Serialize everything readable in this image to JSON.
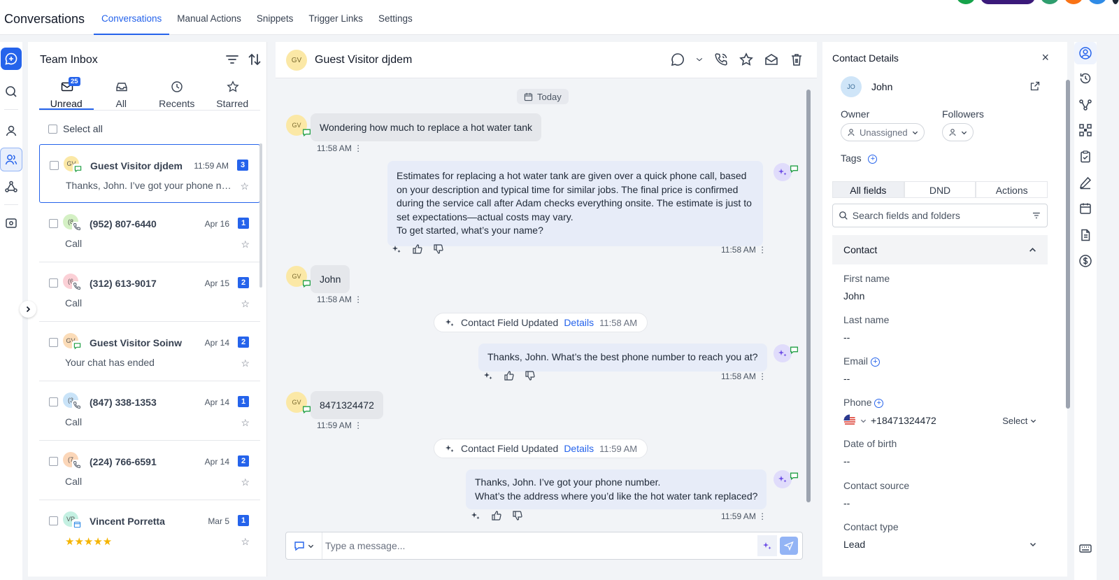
{
  "app": {
    "title": "Conversations"
  },
  "nav": {
    "tabs": [
      "Conversations",
      "Manual Actions",
      "Snippets",
      "Trigger Links",
      "Settings"
    ]
  },
  "colors": {
    "accent": "#2563eb",
    "avatar_gv": "#fbe8a6",
    "bubble_out": "#e7ecf8",
    "bubble_in": "#e5e7eb"
  },
  "inbox": {
    "title": "Team Inbox",
    "tabs": [
      {
        "label": "Unread",
        "badge": "25",
        "icon": "inbox-icon"
      },
      {
        "label": "All",
        "icon": "tray-icon"
      },
      {
        "label": "Recents",
        "icon": "clock-icon"
      },
      {
        "label": "Starred",
        "icon": "star-icon"
      }
    ],
    "select_all": "Select all",
    "conversations": [
      {
        "initials": "GV",
        "name": "Guest Visitor djdem",
        "time": "11:59 AM",
        "count": "3",
        "preview": "Thanks, John. I’ve got your phone number. What’s the address where you’d like the hot water tank replaced?",
        "avatar_color": "#fbe8a6"
      },
      {
        "initials": "(8",
        "name": "(952) 807-6440",
        "time": "Apr 16",
        "count": "1",
        "preview": "Call",
        "avatar_color": "#d4f0c4"
      },
      {
        "initials": "(6",
        "name": "(312) 613-9017",
        "time": "Apr 15",
        "count": "2",
        "preview": "Call",
        "avatar_color": "#fbd0d6"
      },
      {
        "initials": "GV",
        "name": "Guest Visitor Soinw",
        "time": "Apr 14",
        "count": "2",
        "preview": "Your chat has ended",
        "avatar_color": "#fbdcb8"
      },
      {
        "initials": "(3",
        "name": "(847) 338-1353",
        "time": "Apr 14",
        "count": "1",
        "preview": "Call",
        "avatar_color": "#c9e3f8"
      },
      {
        "initials": "(7",
        "name": "(224) 766-6591",
        "time": "Apr 14",
        "count": "2",
        "preview": "Call",
        "avatar_color": "#fbd6b8"
      },
      {
        "initials": "VP",
        "name": "Vincent Porretta",
        "time": "Mar 5",
        "count": "1",
        "preview": "★★★★★",
        "avatar_color": "#c4f0e2"
      }
    ]
  },
  "chat": {
    "contact_initials": "GV",
    "contact_name": "Guest Visitor djdem",
    "today": "Today",
    "messages": {
      "m1": {
        "text": "Wondering how much to replace a hot water tank",
        "time": "11:58 AM"
      },
      "m2": {
        "line1": "Estimates for replacing a hot water tank are given over a quick phone call, based",
        "line2": "on your description and typical time for similar jobs. The final price is confirmed",
        "line3": "during the service call after Adam checks everything onsite. The estimate is just to",
        "line4": "set expectations—actual costs may vary.",
        "line5": "To get started, what’s your name?",
        "time": "11:58 AM"
      },
      "m3": {
        "text": "John",
        "time": "11:58 AM"
      },
      "e1": {
        "text": "Contact Field Updated",
        "link": "Details",
        "time": "11:58 AM"
      },
      "m4": {
        "text": "Thanks, John. What’s the best phone number to reach you at?",
        "time": "11:58 AM"
      },
      "m5": {
        "text": "8471324472",
        "time": "11:59 AM"
      },
      "e2": {
        "text": "Contact Field Updated",
        "link": "Details",
        "time": "11:59 AM"
      },
      "m6": {
        "line1": "Thanks, John. I’ve got your phone number.",
        "line2": "What’s the address where you’d like the hot water tank replaced?",
        "time": "11:59 AM"
      }
    },
    "composer_placeholder": "Type a message..."
  },
  "contact": {
    "title": "Contact Details",
    "initials": "JO",
    "name": "John",
    "owner_label": "Owner",
    "owner_value": "Unassigned",
    "followers_label": "Followers",
    "tags_label": "Tags",
    "tabs": [
      "All fields",
      "DND",
      "Actions"
    ],
    "search_placeholder": "Search fields and folders",
    "section": "Contact",
    "fields": {
      "first_name": {
        "label": "First name",
        "value": "John"
      },
      "last_name": {
        "label": "Last name",
        "value": "--"
      },
      "email": {
        "label": "Email",
        "value": "--"
      },
      "phone": {
        "label": "Phone",
        "value": "+18471324472",
        "select": "Select"
      },
      "dob": {
        "label": "Date of birth",
        "value": "--"
      },
      "source": {
        "label": "Contact source",
        "value": "--"
      },
      "type": {
        "label": "Contact type",
        "value": "Lead"
      }
    }
  }
}
